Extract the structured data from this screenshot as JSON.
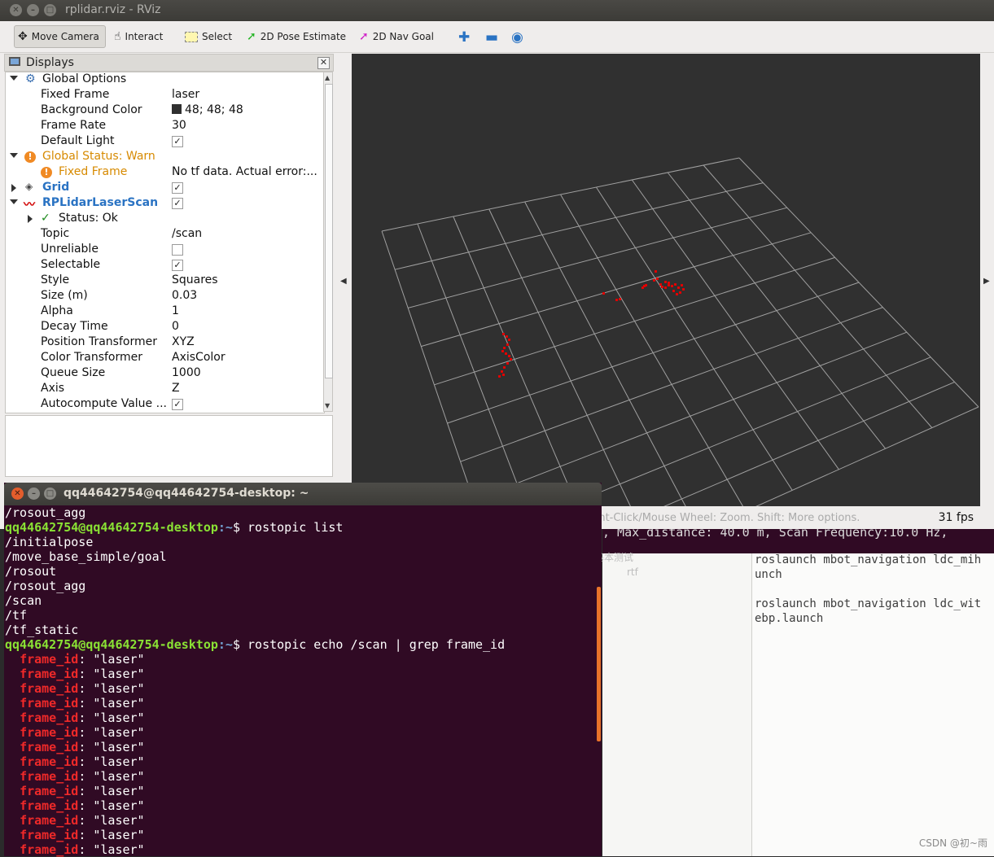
{
  "rviz": {
    "title": "rplidar.rviz - RViz",
    "toolbar": {
      "move_camera": "Move Camera",
      "interact": "Interact",
      "select": "Select",
      "pose_estimate": "2D Pose Estimate",
      "nav_goal": "2D Nav Goal"
    },
    "displays": {
      "title": "Displays",
      "rows": {
        "global_options": "Global Options",
        "fixed_frame": "Fixed Frame",
        "fixed_frame_val": "laser",
        "background_color": "Background Color",
        "background_color_val": "48; 48; 48",
        "frame_rate": "Frame Rate",
        "frame_rate_val": "30",
        "default_light": "Default Light",
        "global_status": "Global Status: Warn",
        "status_fixed_frame": "Fixed Frame",
        "status_fixed_frame_val": "No tf data.  Actual error:...",
        "grid": "Grid",
        "scan": "RPLidarLaserScan",
        "status_ok": "Status: Ok",
        "topic": "Topic",
        "topic_val": "/scan",
        "unreliable": "Unreliable",
        "selectable": "Selectable",
        "style": "Style",
        "style_val": "Squares",
        "size": "Size (m)",
        "size_val": "0.03",
        "alpha": "Alpha",
        "alpha_val": "1",
        "decay": "Decay Time",
        "decay_val": "0",
        "pos_transformer": "Position Transformer",
        "pos_transformer_val": "XYZ",
        "color_transformer": "Color Transformer",
        "color_transformer_val": "AxisColor",
        "queue_size": "Queue Size",
        "queue_size_val": "1000",
        "axis": "Axis",
        "axis_val": "Z",
        "autocompute": "Autocompute Value ...",
        "checked": "✓"
      }
    },
    "statusbar": {
      "hint": "Left-Click: Rotate.  Middle-Click: Move X/Y.  Right-Click/Mouse Wheel: Zoom.  Shift: More options.",
      "fps": "31 fps"
    }
  },
  "terminal": {
    "title": "qq44642754@qq44642754-desktop: ~",
    "user_host": "qq44642754@qq44642754-desktop",
    "path": ":~",
    "dollar": "$ ",
    "cmd1": "rostopic list",
    "cmd2": "rostopic echo /scan | grep frame_id",
    "first_line": "/rosout_agg",
    "topics": [
      "/initialpose",
      "/move_base_simple/goal",
      "/rosout",
      "/rosout_agg",
      "/scan",
      "/tf",
      "/tf_static"
    ],
    "frame_key": "frame_id",
    "frame_val": ": \"laser\""
  },
  "background": {
    "terminal_line": ", Max_distance: 40.0 m, Scan Frequency:10.0 Hz,",
    "editor_lines": [
      "roslaunch mbot_navigation ldc_mih",
      "unch",
      "",
      "roslaunch mbot_navigation ldc_wit",
      "ebp.launch"
    ],
    "faded_1": "基本测试",
    "faded_2": "rtf",
    "watermark": "CSDN @初~雨"
  },
  "colors": {
    "terminal_bg": "#300a24",
    "prompt_green": "#8ae234",
    "prompt_blue": "#729fcf",
    "frame_red": "#ef2929",
    "view_bg": "#303030",
    "scan_points": "#e00000"
  }
}
